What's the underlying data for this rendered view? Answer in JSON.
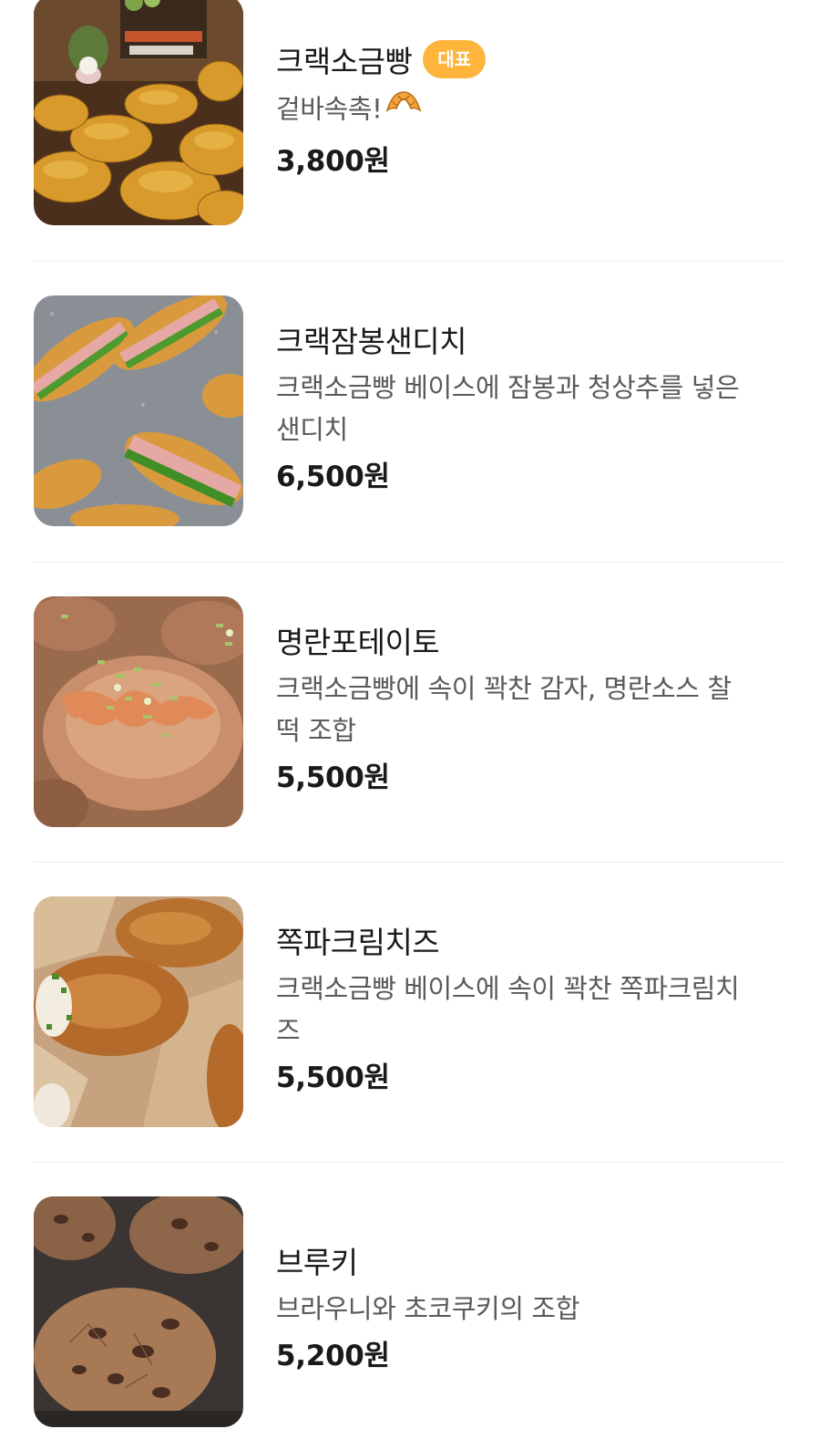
{
  "menu": {
    "items": [
      {
        "name": "크랙소금빵",
        "badge": "대표",
        "description": "겉바속촉!",
        "description_emoji_icon": "croissant-icon",
        "price": "3,800원",
        "image_icon": "salt-bread-photo"
      },
      {
        "name": "크랙잠봉샌디치",
        "description_line1": "크랙소금빵 베이스에 잠봉과 청상추를 넣은",
        "description_line2": "샌디치",
        "price": "6,500원",
        "image_icon": "jambon-sandwich-photo"
      },
      {
        "name": "명란포테이토",
        "description_line1": "크랙소금빵에 속이 꽉찬 감자, 명란소스 찰",
        "description_line2": "떡 조합",
        "price": "5,500원",
        "image_icon": "mentaiko-potato-bread-photo"
      },
      {
        "name": "쪽파크림치즈",
        "description_line1": "크랙소금빵 베이스에 속이 꽉찬 쪽파크림치",
        "description_line2": "즈",
        "price": "5,500원",
        "image_icon": "scallion-cream-cheese-bread-photo"
      },
      {
        "name": "브루키",
        "description": "브라우니와 초코쿠키의 조합",
        "price": "5,200원",
        "image_icon": "brookie-photo"
      }
    ]
  },
  "colors": {
    "badge_bg": "#ffb43c",
    "name_text": "#1a1a1a",
    "desc_text": "#5a5a5a",
    "divider": "#ececec"
  }
}
